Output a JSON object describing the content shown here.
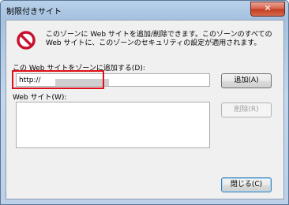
{
  "window": {
    "title": "制限付きサイト",
    "close_glyph": "✕"
  },
  "message": {
    "icon": "prohibit-icon",
    "text": "このゾーンに Web サイトを追加/削除できます。このゾーンのすべての Web サイトに、このゾーンのセキュリティの設定が適用されます。"
  },
  "add_section": {
    "label": "この Web サイトをゾーンに追加する(D):",
    "url_value": "http://",
    "add_button": "追加(A)"
  },
  "sites_section": {
    "label": "Web サイト(W):",
    "remove_button": "削除(R)"
  },
  "footer": {
    "close_button": "閉じる(C)"
  },
  "colors": {
    "highlight": "#e0101a",
    "title_bar": "#b9d1ea"
  }
}
